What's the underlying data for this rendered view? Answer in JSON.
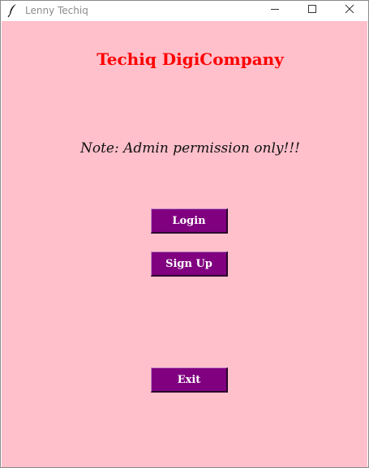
{
  "window": {
    "title": "Lenny Techiq",
    "icon": "feather-icon"
  },
  "titlebar_buttons": {
    "minimize_icon": "minimize-icon",
    "maximize_icon": "maximize-icon",
    "close_icon": "close-icon"
  },
  "main": {
    "heading": "Techiq DigiCompany",
    "note": "Note: Admin permission only!!!",
    "login_label": "Login",
    "signup_label": "Sign Up",
    "exit_label": "Exit"
  },
  "colors": {
    "background": "#ffc0cb",
    "heading": "#ff0000",
    "button": "#800080",
    "button_text": "#ffffff"
  }
}
